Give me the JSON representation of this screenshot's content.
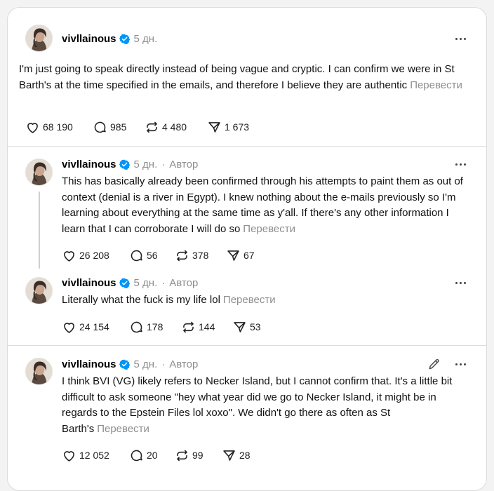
{
  "translate_label": "Перевести",
  "author_label": "Автор",
  "colors": {
    "verified": "#0095f6",
    "muted": "#8e8e8e",
    "divider": "#dcdcdc"
  },
  "posts": [
    {
      "username": "vivllainous",
      "time": "5 дн.",
      "text": "I'm just going to speak directly instead of being vague and cryptic. I can confirm we were in St Barth's at the time specified in the emails, and therefore I believe they are authentic",
      "likes": "68 190",
      "comments": "985",
      "reposts": "4 480",
      "shares": "1 673"
    },
    {
      "username": "vivllainous",
      "time": "5 дн.",
      "text": "This has basically already been confirmed through his attempts to paint them as out of context (denial is a river in Egypt). I knew nothing about the e-mails previously so I'm learning about everything at the same time as y'all. If there's any other information I learn that I can corroborate I will do so",
      "likes": "26 208",
      "comments": "56",
      "reposts": "378",
      "shares": "67"
    },
    {
      "username": "vivllainous",
      "time": "5 дн.",
      "text": "Literally what the fuck is my life lol",
      "likes": "24 154",
      "comments": "178",
      "reposts": "144",
      "shares": "53"
    },
    {
      "username": "vivllainous",
      "time": "5 дн.",
      "text": "I think BVI (VG) likely refers to Necker Island, but I cannot confirm that. It's a little bit difficult to ask someone \"hey what year did we go to Necker Island, it might be in regards to the Epstein Files lol xoxo\". We didn't go there as often as St Barth's",
      "likes": "12 052",
      "comments": "20",
      "reposts": "99",
      "shares": "28"
    }
  ]
}
